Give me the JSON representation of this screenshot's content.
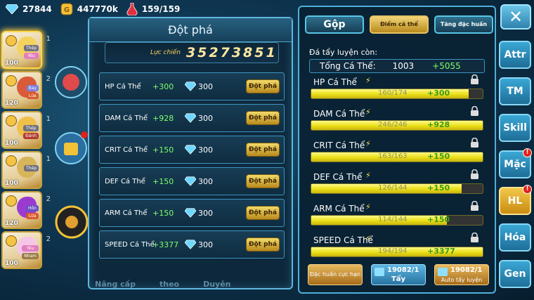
{
  "topbar": {
    "gems": "27844",
    "gold": "447770k",
    "energy": "159/159"
  },
  "units": [
    {
      "level": "100",
      "tags": [
        "Thép",
        "Yêu"
      ],
      "star": "1",
      "color": "#f3d35e"
    },
    {
      "level": "120",
      "tags": [
        "Bay",
        "Lửa"
      ],
      "star": "2",
      "color": "#d95b3a"
    },
    {
      "level": "100",
      "tags": [
        "Thép",
        "Đánh"
      ],
      "star": "1",
      "color": "#f0c04a"
    },
    {
      "level": "100",
      "tags": [
        "Thép"
      ],
      "star": "1",
      "color": "#d7b55a"
    },
    {
      "level": "120",
      "tags": [
        "Hồn",
        "Lửa"
      ],
      "star": "2",
      "color": "#9b3ad0"
    },
    {
      "level": "100",
      "tags": [
        "Yêu",
        "Nham"
      ],
      "star": "2",
      "color": "#f4c6e8"
    }
  ],
  "panel": {
    "title": "Đột phá",
    "power_label": "Lực chiến",
    "power_value": "35273851",
    "rows": [
      {
        "name": "HP Cá Thể",
        "bonus": "+300",
        "cost": "300",
        "button": "Đột phá"
      },
      {
        "name": "DAM Cá Thể",
        "bonus": "+928",
        "cost": "300",
        "button": "Đột phá"
      },
      {
        "name": "CRIT Cá Thể",
        "bonus": "+150",
        "cost": "300",
        "button": "Đột phá"
      },
      {
        "name": "DEF Cá Thể",
        "bonus": "+150",
        "cost": "300",
        "button": "Đột phá"
      },
      {
        "name": "ARM Cá Thể",
        "bonus": "+150",
        "cost": "300",
        "button": "Đột phá"
      },
      {
        "name": "SPEED Cá Thể",
        "bonus": "+3377",
        "cost": "300",
        "button": "Đột phá"
      }
    ],
    "bottom_labels": [
      "Nâng cấp",
      "theo",
      "Duyên"
    ]
  },
  "right": {
    "tabs": [
      "Gộp",
      "Điểm cá thể",
      "Tăng đặc huấn"
    ],
    "remain_label": "Đá tẩy luyện còn:",
    "total_label": "Tổng Cá Thể:",
    "total_value": "1003",
    "total_bonus": "+5055",
    "stats": [
      {
        "name": "HP Cá Thể",
        "current": "160/174",
        "add": "+300",
        "fill": 0.92
      },
      {
        "name": "DAM Cá Thể",
        "current": "246/246",
        "add": "+928",
        "fill": 1.0
      },
      {
        "name": "CRIT Cá Thể",
        "current": "163/163",
        "add": "+150",
        "fill": 1.0
      },
      {
        "name": "DEF Cá Thể",
        "current": "126/144",
        "add": "+150",
        "fill": 0.875
      },
      {
        "name": "ARM Cá Thể",
        "current": "114/144",
        "add": "+150",
        "fill": 0.79
      },
      {
        "name": "SPEED Cá Thể",
        "current": "194/194",
        "add": "+3377",
        "fill": 1.0
      }
    ],
    "btn_special": "Đặc huấn cực hạn",
    "btn_wash_count": "19082/1",
    "btn_wash_label": "Tẩy",
    "btn_auto_count": "19082/1",
    "btn_auto_label": "Auto tẩy luyện"
  },
  "nav": [
    {
      "label": "Attr",
      "badge": ""
    },
    {
      "label": "TM",
      "badge": ""
    },
    {
      "label": "Skill",
      "badge": ""
    },
    {
      "label": "Mặc",
      "badge": "!"
    },
    {
      "label": "HL",
      "badge": "!",
      "active": true
    },
    {
      "label": "Hóa",
      "badge": ""
    },
    {
      "label": "Gen",
      "badge": ""
    }
  ],
  "close_label": "✕"
}
